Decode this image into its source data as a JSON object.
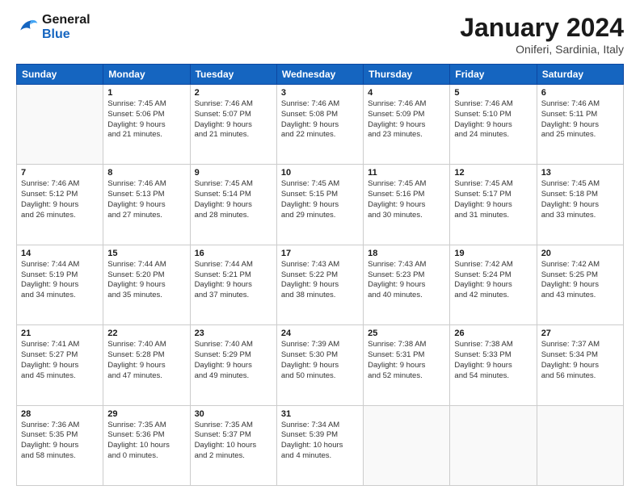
{
  "logo": {
    "line1": "General",
    "line2": "Blue"
  },
  "title": "January 2024",
  "subtitle": "Oniferi, Sardinia, Italy",
  "weekdays": [
    "Sunday",
    "Monday",
    "Tuesday",
    "Wednesday",
    "Thursday",
    "Friday",
    "Saturday"
  ],
  "weeks": [
    [
      {
        "day": "",
        "info": ""
      },
      {
        "day": "1",
        "info": "Sunrise: 7:45 AM\nSunset: 5:06 PM\nDaylight: 9 hours\nand 21 minutes."
      },
      {
        "day": "2",
        "info": "Sunrise: 7:46 AM\nSunset: 5:07 PM\nDaylight: 9 hours\nand 21 minutes."
      },
      {
        "day": "3",
        "info": "Sunrise: 7:46 AM\nSunset: 5:08 PM\nDaylight: 9 hours\nand 22 minutes."
      },
      {
        "day": "4",
        "info": "Sunrise: 7:46 AM\nSunset: 5:09 PM\nDaylight: 9 hours\nand 23 minutes."
      },
      {
        "day": "5",
        "info": "Sunrise: 7:46 AM\nSunset: 5:10 PM\nDaylight: 9 hours\nand 24 minutes."
      },
      {
        "day": "6",
        "info": "Sunrise: 7:46 AM\nSunset: 5:11 PM\nDaylight: 9 hours\nand 25 minutes."
      }
    ],
    [
      {
        "day": "7",
        "info": "Sunrise: 7:46 AM\nSunset: 5:12 PM\nDaylight: 9 hours\nand 26 minutes."
      },
      {
        "day": "8",
        "info": "Sunrise: 7:46 AM\nSunset: 5:13 PM\nDaylight: 9 hours\nand 27 minutes."
      },
      {
        "day": "9",
        "info": "Sunrise: 7:45 AM\nSunset: 5:14 PM\nDaylight: 9 hours\nand 28 minutes."
      },
      {
        "day": "10",
        "info": "Sunrise: 7:45 AM\nSunset: 5:15 PM\nDaylight: 9 hours\nand 29 minutes."
      },
      {
        "day": "11",
        "info": "Sunrise: 7:45 AM\nSunset: 5:16 PM\nDaylight: 9 hours\nand 30 minutes."
      },
      {
        "day": "12",
        "info": "Sunrise: 7:45 AM\nSunset: 5:17 PM\nDaylight: 9 hours\nand 31 minutes."
      },
      {
        "day": "13",
        "info": "Sunrise: 7:45 AM\nSunset: 5:18 PM\nDaylight: 9 hours\nand 33 minutes."
      }
    ],
    [
      {
        "day": "14",
        "info": "Sunrise: 7:44 AM\nSunset: 5:19 PM\nDaylight: 9 hours\nand 34 minutes."
      },
      {
        "day": "15",
        "info": "Sunrise: 7:44 AM\nSunset: 5:20 PM\nDaylight: 9 hours\nand 35 minutes."
      },
      {
        "day": "16",
        "info": "Sunrise: 7:44 AM\nSunset: 5:21 PM\nDaylight: 9 hours\nand 37 minutes."
      },
      {
        "day": "17",
        "info": "Sunrise: 7:43 AM\nSunset: 5:22 PM\nDaylight: 9 hours\nand 38 minutes."
      },
      {
        "day": "18",
        "info": "Sunrise: 7:43 AM\nSunset: 5:23 PM\nDaylight: 9 hours\nand 40 minutes."
      },
      {
        "day": "19",
        "info": "Sunrise: 7:42 AM\nSunset: 5:24 PM\nDaylight: 9 hours\nand 42 minutes."
      },
      {
        "day": "20",
        "info": "Sunrise: 7:42 AM\nSunset: 5:25 PM\nDaylight: 9 hours\nand 43 minutes."
      }
    ],
    [
      {
        "day": "21",
        "info": "Sunrise: 7:41 AM\nSunset: 5:27 PM\nDaylight: 9 hours\nand 45 minutes."
      },
      {
        "day": "22",
        "info": "Sunrise: 7:40 AM\nSunset: 5:28 PM\nDaylight: 9 hours\nand 47 minutes."
      },
      {
        "day": "23",
        "info": "Sunrise: 7:40 AM\nSunset: 5:29 PM\nDaylight: 9 hours\nand 49 minutes."
      },
      {
        "day": "24",
        "info": "Sunrise: 7:39 AM\nSunset: 5:30 PM\nDaylight: 9 hours\nand 50 minutes."
      },
      {
        "day": "25",
        "info": "Sunrise: 7:38 AM\nSunset: 5:31 PM\nDaylight: 9 hours\nand 52 minutes."
      },
      {
        "day": "26",
        "info": "Sunrise: 7:38 AM\nSunset: 5:33 PM\nDaylight: 9 hours\nand 54 minutes."
      },
      {
        "day": "27",
        "info": "Sunrise: 7:37 AM\nSunset: 5:34 PM\nDaylight: 9 hours\nand 56 minutes."
      }
    ],
    [
      {
        "day": "28",
        "info": "Sunrise: 7:36 AM\nSunset: 5:35 PM\nDaylight: 9 hours\nand 58 minutes."
      },
      {
        "day": "29",
        "info": "Sunrise: 7:35 AM\nSunset: 5:36 PM\nDaylight: 10 hours\nand 0 minutes."
      },
      {
        "day": "30",
        "info": "Sunrise: 7:35 AM\nSunset: 5:37 PM\nDaylight: 10 hours\nand 2 minutes."
      },
      {
        "day": "31",
        "info": "Sunrise: 7:34 AM\nSunset: 5:39 PM\nDaylight: 10 hours\nand 4 minutes."
      },
      {
        "day": "",
        "info": ""
      },
      {
        "day": "",
        "info": ""
      },
      {
        "day": "",
        "info": ""
      }
    ]
  ]
}
